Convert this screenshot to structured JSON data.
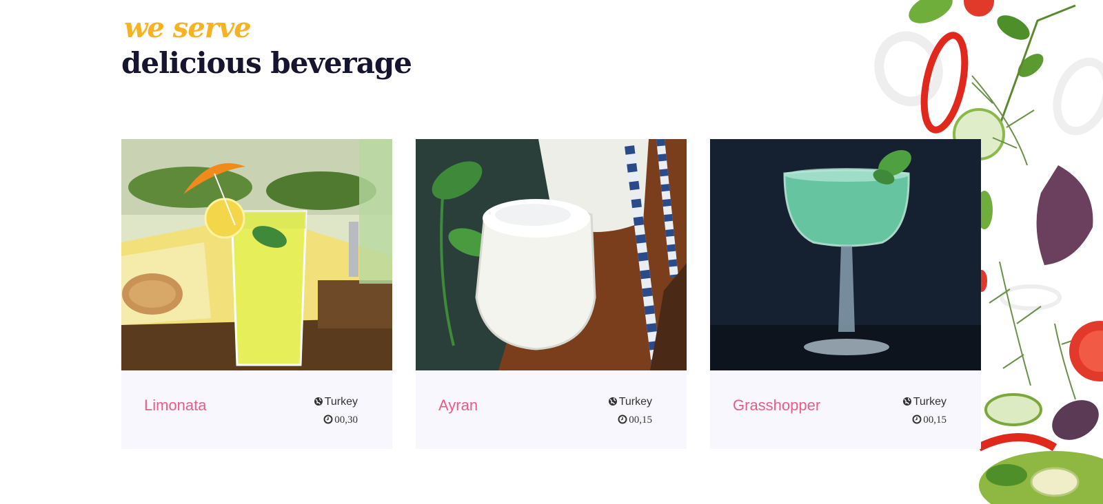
{
  "section": {
    "subtitle": "we serve",
    "title": "delicious beverage"
  },
  "cards": [
    {
      "name": "Limonata",
      "origin": "Turkey",
      "time": "00,30",
      "image": "lemonade-glass",
      "origin_icon": "globe-icon",
      "time_icon": "clock-icon"
    },
    {
      "name": "Ayran",
      "origin": "Turkey",
      "time": "00,15",
      "image": "ayran-glass",
      "origin_icon": "globe-icon",
      "time_icon": "clock-icon"
    },
    {
      "name": "Grasshopper",
      "origin": "Turkey",
      "time": "00,15",
      "image": "grasshopper-cocktail",
      "origin_icon": "globe-icon",
      "time_icon": "clock-icon"
    }
  ],
  "colors": {
    "accent_subtitle": "#f5b324",
    "title": "#161530",
    "card_name": "#ea5d83",
    "card_bg": "#f8f7fd"
  }
}
